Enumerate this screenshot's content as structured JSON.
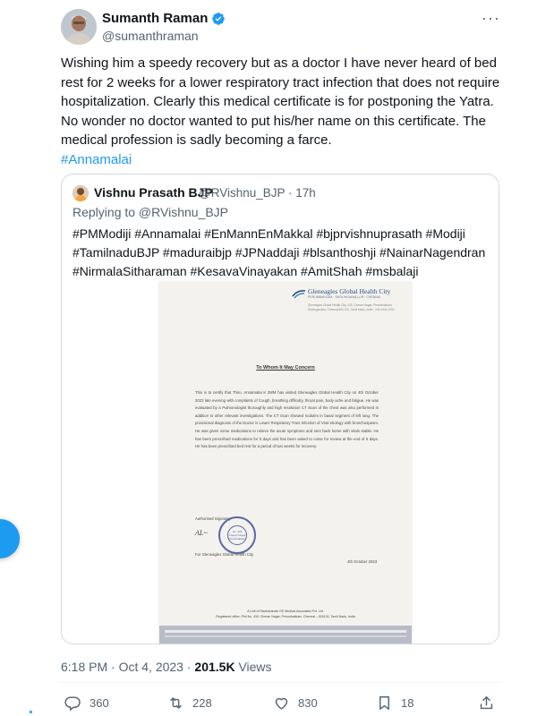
{
  "tweet": {
    "author_name": "Sumanth Raman",
    "author_handle": "@sumanthraman",
    "more_label": "···",
    "text": "Wishing him a speedy recovery but as a doctor I have never heard of bed rest for 2 weeks for a lower respiratory tract infection that does not require hospitalization. Clearly this medical certificate is for postponing the Yatra. No wonder no doctor wanted to put his/her name on this certificate. The medical profession is sadly becoming a farce.",
    "hashtag": "#Annamalai",
    "time": "6:18 PM · Oct 4, 2023 · ",
    "views_count": "201.5K",
    "views_label": " Views"
  },
  "quote": {
    "author_name": "Vishnu Prasath BJP",
    "author_handle": "@RVishnu_BJP · 17h",
    "replying_to": "Replying to @RVishnu_BJP",
    "hashtags": "#PMModiji #Annamalai #EnMannEnMakkal #bjprvishnuprasath #Modiji #TamilnaduBJP #maduraibjp #JPNaddaji #blsanthoshji #NainarNagendran #NirmalaSitharaman #KesavaVinayakan #AmitShah #msbalaji"
  },
  "certificate": {
    "logo": "Gleneagles Global Health City",
    "logo_sub": "PERUMBAKKAM · SHOLINGANALLUR · CHENNAI",
    "address": "Gleneagles Global Health City, 439, Cheran Nagar, Perumbakkam, Sholinganallur, Chennai 600 100, Tamil Nadu, India · 044 4444 1000",
    "title": "To Whom It May Concern",
    "body": "This is to certify that Thiru. Annamalai K 39/M has visited Gleneagles Global Health City on 4th October 2023 late evening with complaints of Cough, breathing difficulty, throat pain, body ache and fatigue. He was evaluated by a Pulmonologist thoroughly and high resolution CT Scan of the chest was also performed in addition to other relevant investigations. The CT Scan showed nodules in basal segment of left lung. The provisional diagnosis of the Doctor is Lower Respiratory Tract Infection of Viral etiology with bronchospasm. He was given some medications to relieve the acute symptoms and sent back home with vitals stable. He has been prescribed medications for 5 days and has been asked to come for review at the end of 5 days. He has been prescribed bed rest for a period of two weeks for recovery.",
    "sig_label": "Authorised Signatory",
    "sig_scrawl": "AL~",
    "stamp_text": "No. 439 Cheran Nagar Perumbakkam",
    "for_line": "For Gleneagles Global Health City",
    "date": "4th October 2023",
    "footer1": "A Unit of Ravindranath GE Medical Associates Pvt. Ltd.",
    "footer2": "Registered office: Plot No. 439, Cheran Nagar, Perumbakkam, Chennai – 600100, Tamil Nadu, India"
  },
  "actions": {
    "replies": "360",
    "retweets": "228",
    "likes": "830",
    "bookmarks": "18"
  },
  "colors": {
    "accent": "#1d9bf0",
    "text": "#0f1419",
    "muted": "#536471",
    "border": "#cfd9de"
  },
  "icons": [
    "verified-badge-icon",
    "more-icon",
    "reply-icon",
    "retweet-icon",
    "like-icon",
    "bookmark-icon",
    "share-icon"
  ]
}
